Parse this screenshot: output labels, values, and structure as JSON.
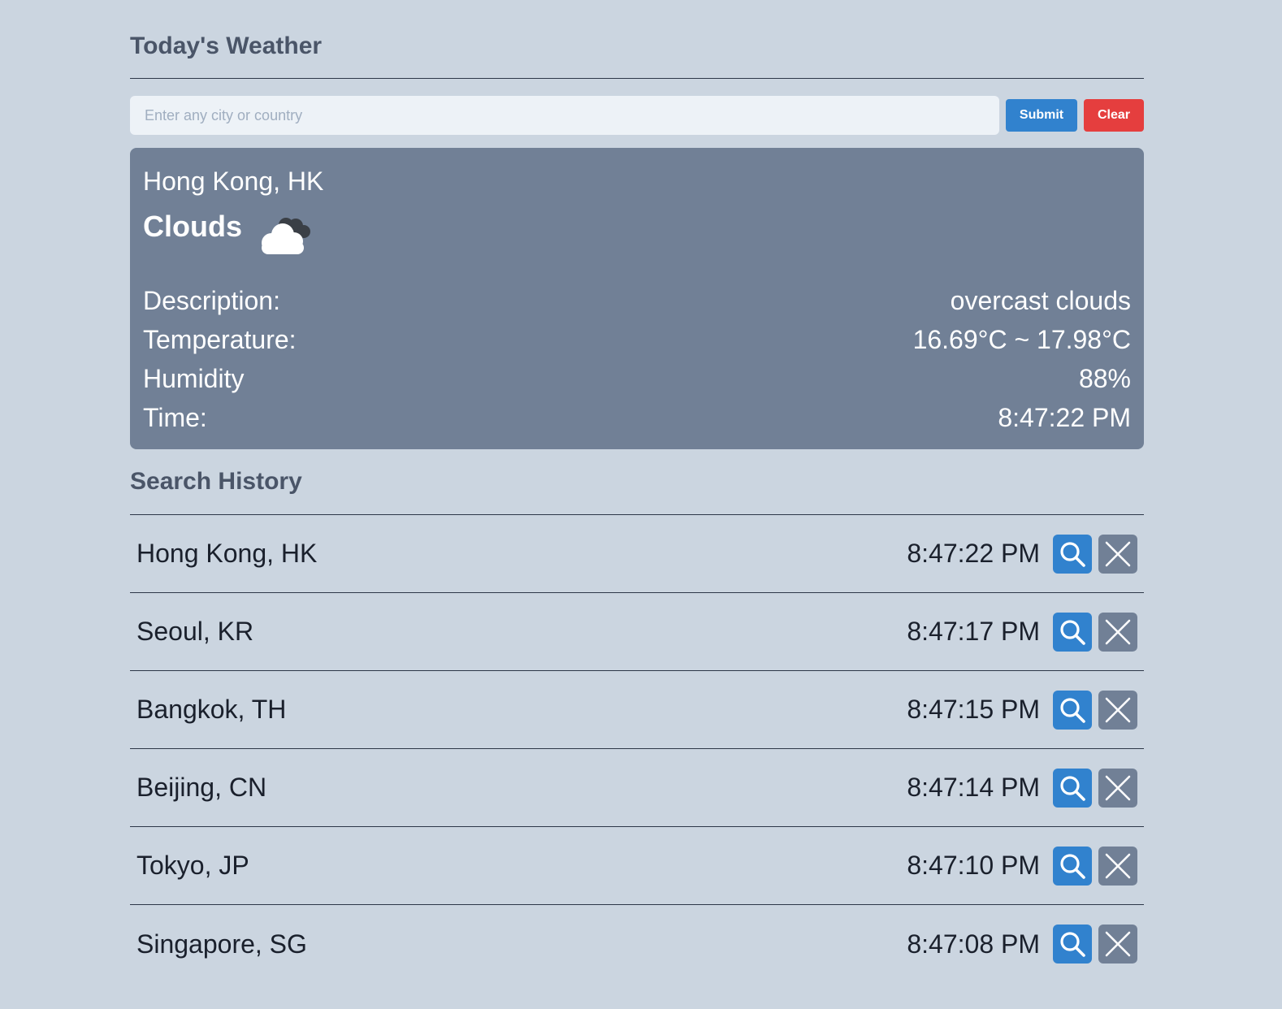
{
  "header": {
    "title": "Today's Weather"
  },
  "search": {
    "placeholder": "Enter any city or country",
    "value": "",
    "submit_label": "Submit",
    "clear_label": "Clear"
  },
  "current": {
    "location": "Hong Kong, HK",
    "condition": "Clouds",
    "condition_icon": "cloud-icon",
    "details": [
      {
        "label": "Description:",
        "value": "overcast clouds"
      },
      {
        "label": "Temperature:",
        "value": "16.69°C ~ 17.98°C"
      },
      {
        "label": "Humidity",
        "value": "88%"
      },
      {
        "label": "Time:",
        "value": "8:47:22 PM"
      }
    ]
  },
  "history": {
    "title": "Search History",
    "items": [
      {
        "city": "Hong Kong, HK",
        "time": "8:47:22 PM"
      },
      {
        "city": "Seoul, KR",
        "time": "8:47:17 PM"
      },
      {
        "city": "Bangkok, TH",
        "time": "8:47:15 PM"
      },
      {
        "city": "Beijing, CN",
        "time": "8:47:14 PM"
      },
      {
        "city": "Tokyo, JP",
        "time": "8:47:10 PM"
      },
      {
        "city": "Singapore, SG",
        "time": "8:47:08 PM"
      }
    ],
    "search_icon": "search-icon",
    "delete_icon": "close-icon"
  },
  "colors": {
    "background": "#cbd5e0",
    "card": "#718096",
    "submit": "#3182ce",
    "clear": "#e53e3e",
    "heading": "#4a5568"
  }
}
